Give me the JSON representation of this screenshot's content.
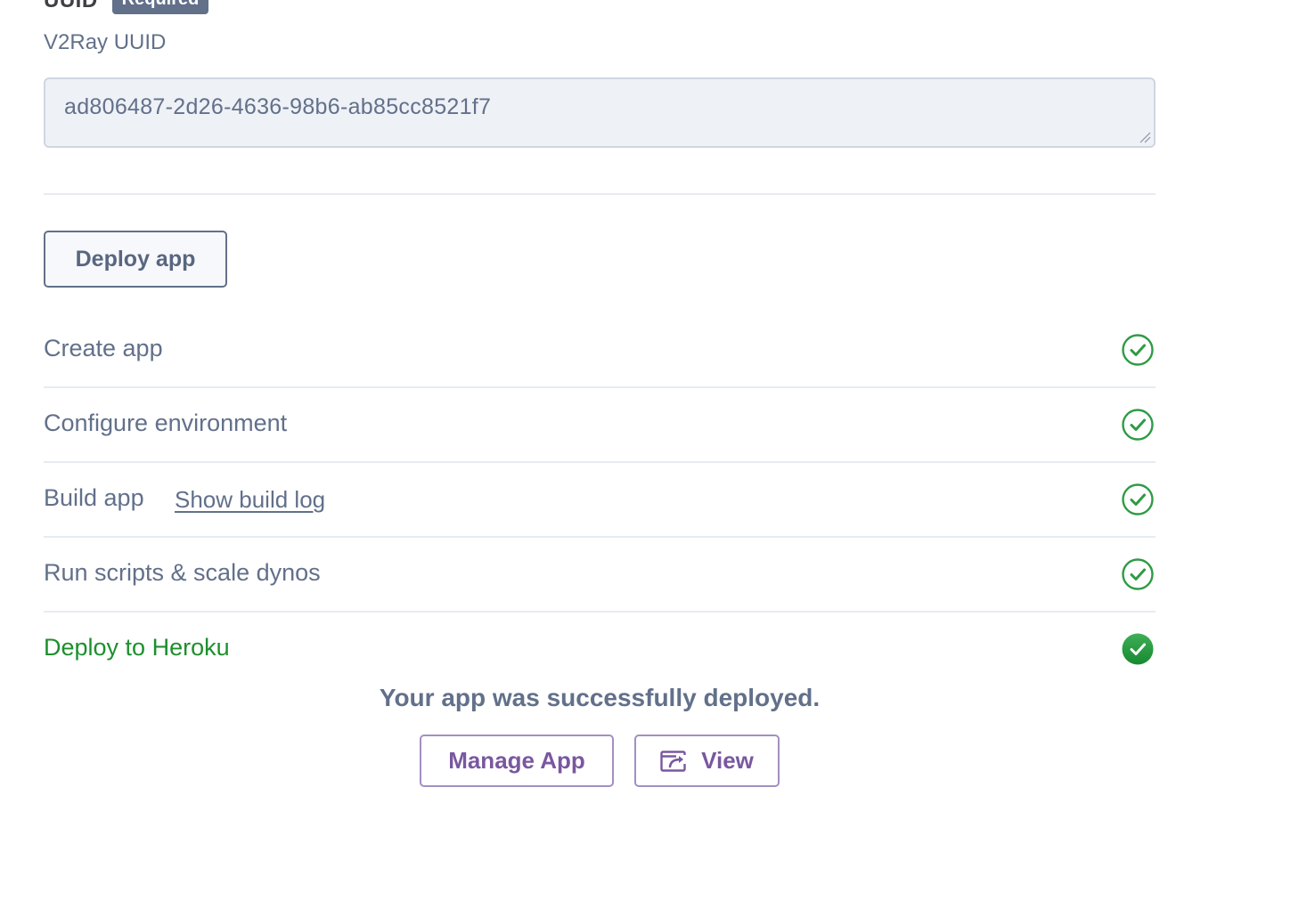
{
  "field": {
    "name": "UUID",
    "required_badge": "Required",
    "description": "V2Ray UUID",
    "value": "ad806487-2d26-4636-98b6-ab85cc8521f7"
  },
  "deploy_button": {
    "label": "Deploy app"
  },
  "steps": [
    {
      "label": "Create app",
      "status": "done",
      "icon": "check-circle-outline-icon"
    },
    {
      "label": "Configure environment",
      "status": "done",
      "icon": "check-circle-outline-icon"
    },
    {
      "label": "Build app",
      "link": "Show build log",
      "status": "done",
      "icon": "check-circle-outline-icon"
    },
    {
      "label": "Run scripts & scale dynos",
      "status": "done",
      "icon": "check-circle-outline-icon"
    },
    {
      "label": "Deploy to Heroku",
      "status": "success",
      "icon": "check-circle-filled-icon"
    }
  ],
  "result": {
    "message": "Your app was successfully deployed.",
    "manage_label": "Manage App",
    "view_label": "View",
    "view_icon": "open-window-icon"
  },
  "colors": {
    "text_muted": "#62708a",
    "success_green": "#1d8f2d",
    "purple": "#79589f",
    "input_bg": "#eef1f6"
  }
}
